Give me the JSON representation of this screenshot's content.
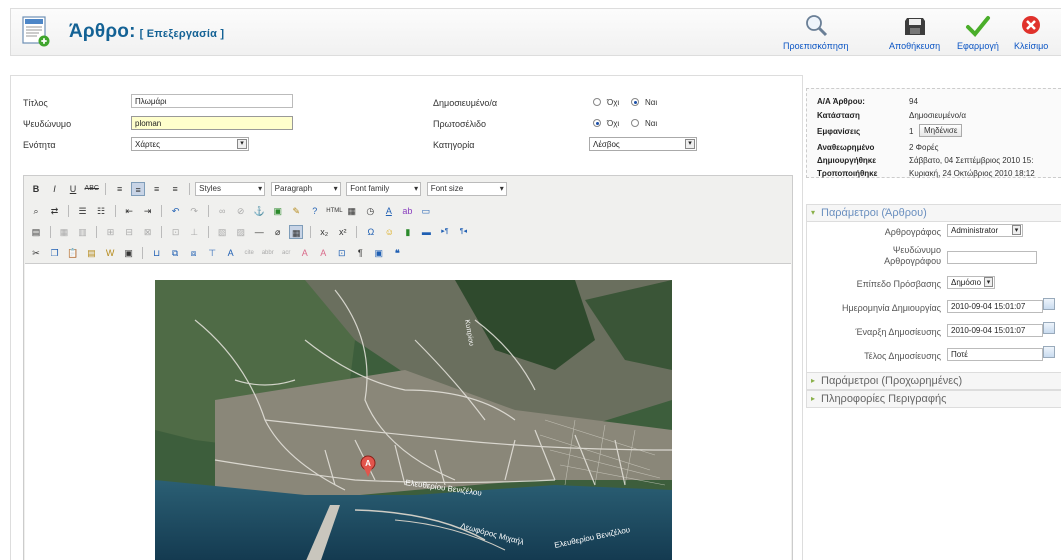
{
  "header": {
    "title": "Άρθρο:",
    "subtitle": "[ Επεξεργασία ]",
    "buttons": [
      {
        "label": "Προεπισκόπηση",
        "icon": "preview-icon"
      },
      {
        "label": "Αποθήκευση",
        "icon": "save-icon"
      },
      {
        "label": "Εφαρμογή",
        "icon": "apply-icon"
      },
      {
        "label": "Κλείσιμο",
        "icon": "close-icon"
      }
    ]
  },
  "form": {
    "title_label": "Τίτλος",
    "title_value": "Πλωμάρι",
    "alias_label": "Ψευδώνυμο",
    "alias_value": "ploman",
    "section_label": "Ενότητα",
    "section_value": "Χάρτες",
    "published_label": "Δημοσιευμένο/α",
    "frontpage_label": "Πρωτοσέλιδο",
    "category_label": "Κατηγορία",
    "category_value": "Λέσβος",
    "no_label": "Όχι",
    "yes_label": "Ναι",
    "published_value": "Ναι",
    "frontpage_value": "Όχι"
  },
  "editor": {
    "styles_label": "Styles",
    "paragraph_label": "Paragraph",
    "fontfamily_label": "Font family",
    "fontsize_label": "Font size",
    "map_marker": "A",
    "map_labels": [
      "Ελευθερίου Βενιζέλου",
      "Λεωφόρος Μιχαήλ",
      "Ελευθερίου Βενιζέλου",
      "Κυπρίου"
    ]
  },
  "info": {
    "id_label": "Α/Α Άρθρου:",
    "id_value": "94",
    "state_label": "Κατάσταση",
    "state_value": "Δημοσιευμένο/α",
    "hits_label": "Εμφανίσεις",
    "hits_value": "1",
    "reset_label": "Μηδένισε",
    "revised_label": "Αναθεωρημένο",
    "revised_value": "2 Φορές",
    "created_label": "Δημιουργήθηκε",
    "created_value": "Σάββατο, 04 Σεπτέμβριος 2010 15:",
    "modified_label": "Τροποποιήθηκε",
    "modified_value": "Κυριακή, 24 Οκτώβριος 2010 18:12"
  },
  "params": {
    "header": "Παράμετροι (Άρθρου)",
    "author_label": "Αρθρογράφος",
    "author_value": "Administrator",
    "alias_label_1": "Ψευδώνυμο",
    "alias_label_2": "Αρθρογράφου",
    "access_label": "Επίπεδο Πρόσβασης",
    "access_value": "Δημόσιο",
    "created_label": "Ημερομηνία Δημιουργίας",
    "created_value": "2010-09-04 15:01:07",
    "start_label": "Έναρξη Δημοσίευσης",
    "start_value": "2010-09-04 15:01:07",
    "end_label": "Τέλος Δημοσίευσης",
    "end_value": "Ποτέ",
    "advanced_header": "Παράμετροι (Προχωρημένες)",
    "meta_header": "Πληροφορίες Περιγραφής"
  }
}
